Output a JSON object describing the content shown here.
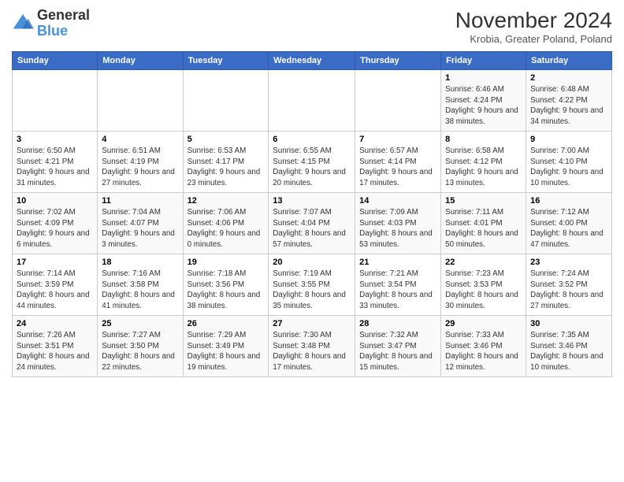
{
  "logo": {
    "general": "General",
    "blue": "Blue"
  },
  "title": "November 2024",
  "subtitle": "Krobia, Greater Poland, Poland",
  "days_header": [
    "Sunday",
    "Monday",
    "Tuesday",
    "Wednesday",
    "Thursday",
    "Friday",
    "Saturday"
  ],
  "weeks": [
    [
      {
        "day": "",
        "info": ""
      },
      {
        "day": "",
        "info": ""
      },
      {
        "day": "",
        "info": ""
      },
      {
        "day": "",
        "info": ""
      },
      {
        "day": "",
        "info": ""
      },
      {
        "day": "1",
        "info": "Sunrise: 6:46 AM\nSunset: 4:24 PM\nDaylight: 9 hours and 38 minutes."
      },
      {
        "day": "2",
        "info": "Sunrise: 6:48 AM\nSunset: 4:22 PM\nDaylight: 9 hours and 34 minutes."
      }
    ],
    [
      {
        "day": "3",
        "info": "Sunrise: 6:50 AM\nSunset: 4:21 PM\nDaylight: 9 hours and 31 minutes."
      },
      {
        "day": "4",
        "info": "Sunrise: 6:51 AM\nSunset: 4:19 PM\nDaylight: 9 hours and 27 minutes."
      },
      {
        "day": "5",
        "info": "Sunrise: 6:53 AM\nSunset: 4:17 PM\nDaylight: 9 hours and 23 minutes."
      },
      {
        "day": "6",
        "info": "Sunrise: 6:55 AM\nSunset: 4:15 PM\nDaylight: 9 hours and 20 minutes."
      },
      {
        "day": "7",
        "info": "Sunrise: 6:57 AM\nSunset: 4:14 PM\nDaylight: 9 hours and 17 minutes."
      },
      {
        "day": "8",
        "info": "Sunrise: 6:58 AM\nSunset: 4:12 PM\nDaylight: 9 hours and 13 minutes."
      },
      {
        "day": "9",
        "info": "Sunrise: 7:00 AM\nSunset: 4:10 PM\nDaylight: 9 hours and 10 minutes."
      }
    ],
    [
      {
        "day": "10",
        "info": "Sunrise: 7:02 AM\nSunset: 4:09 PM\nDaylight: 9 hours and 6 minutes."
      },
      {
        "day": "11",
        "info": "Sunrise: 7:04 AM\nSunset: 4:07 PM\nDaylight: 9 hours and 3 minutes."
      },
      {
        "day": "12",
        "info": "Sunrise: 7:06 AM\nSunset: 4:06 PM\nDaylight: 9 hours and 0 minutes."
      },
      {
        "day": "13",
        "info": "Sunrise: 7:07 AM\nSunset: 4:04 PM\nDaylight: 8 hours and 57 minutes."
      },
      {
        "day": "14",
        "info": "Sunrise: 7:09 AM\nSunset: 4:03 PM\nDaylight: 8 hours and 53 minutes."
      },
      {
        "day": "15",
        "info": "Sunrise: 7:11 AM\nSunset: 4:01 PM\nDaylight: 8 hours and 50 minutes."
      },
      {
        "day": "16",
        "info": "Sunrise: 7:12 AM\nSunset: 4:00 PM\nDaylight: 8 hours and 47 minutes."
      }
    ],
    [
      {
        "day": "17",
        "info": "Sunrise: 7:14 AM\nSunset: 3:59 PM\nDaylight: 8 hours and 44 minutes."
      },
      {
        "day": "18",
        "info": "Sunrise: 7:16 AM\nSunset: 3:58 PM\nDaylight: 8 hours and 41 minutes."
      },
      {
        "day": "19",
        "info": "Sunrise: 7:18 AM\nSunset: 3:56 PM\nDaylight: 8 hours and 38 minutes."
      },
      {
        "day": "20",
        "info": "Sunrise: 7:19 AM\nSunset: 3:55 PM\nDaylight: 8 hours and 35 minutes."
      },
      {
        "day": "21",
        "info": "Sunrise: 7:21 AM\nSunset: 3:54 PM\nDaylight: 8 hours and 33 minutes."
      },
      {
        "day": "22",
        "info": "Sunrise: 7:23 AM\nSunset: 3:53 PM\nDaylight: 8 hours and 30 minutes."
      },
      {
        "day": "23",
        "info": "Sunrise: 7:24 AM\nSunset: 3:52 PM\nDaylight: 8 hours and 27 minutes."
      }
    ],
    [
      {
        "day": "24",
        "info": "Sunrise: 7:26 AM\nSunset: 3:51 PM\nDaylight: 8 hours and 24 minutes."
      },
      {
        "day": "25",
        "info": "Sunrise: 7:27 AM\nSunset: 3:50 PM\nDaylight: 8 hours and 22 minutes."
      },
      {
        "day": "26",
        "info": "Sunrise: 7:29 AM\nSunset: 3:49 PM\nDaylight: 8 hours and 19 minutes."
      },
      {
        "day": "27",
        "info": "Sunrise: 7:30 AM\nSunset: 3:48 PM\nDaylight: 8 hours and 17 minutes."
      },
      {
        "day": "28",
        "info": "Sunrise: 7:32 AM\nSunset: 3:47 PM\nDaylight: 8 hours and 15 minutes."
      },
      {
        "day": "29",
        "info": "Sunrise: 7:33 AM\nSunset: 3:46 PM\nDaylight: 8 hours and 12 minutes."
      },
      {
        "day": "30",
        "info": "Sunrise: 7:35 AM\nSunset: 3:46 PM\nDaylight: 8 hours and 10 minutes."
      }
    ]
  ]
}
